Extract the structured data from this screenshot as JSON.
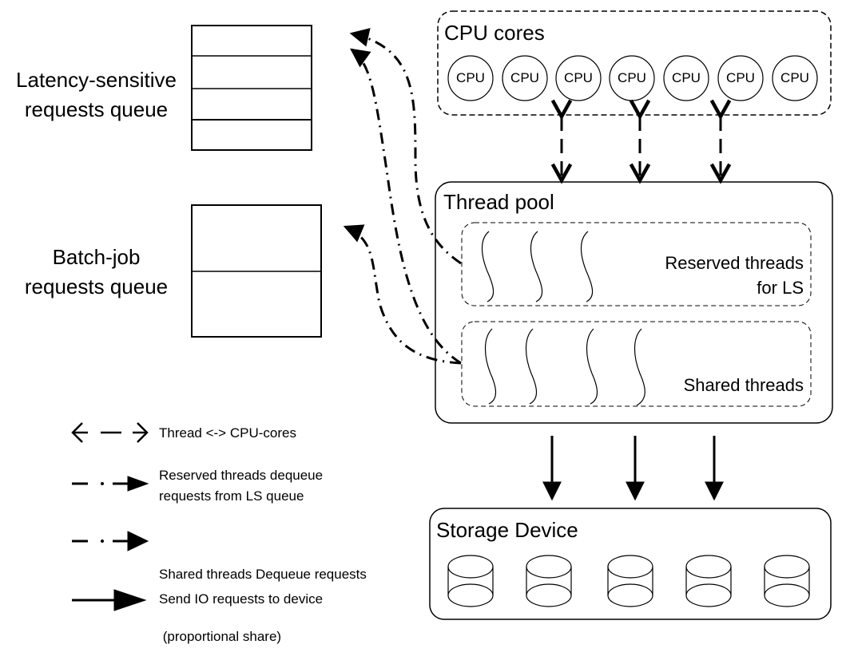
{
  "queues": {
    "ls": {
      "label_line1": "Latency-sensitive",
      "label_line2": "requests queue",
      "slots": 4
    },
    "batch": {
      "label_line1": "Batch-job",
      "label_line2": "requests queue",
      "slots": 2
    }
  },
  "cpu_cores": {
    "title": "CPU cores",
    "cores": [
      "CPU",
      "CPU",
      "CPU",
      "CPU",
      "CPU",
      "CPU",
      "CPU"
    ]
  },
  "thread_pool": {
    "title": "Thread pool",
    "reserved": {
      "label_line1": "Reserved threads",
      "label_line2": "for LS",
      "threads": 3
    },
    "shared": {
      "label": "Shared threads",
      "threads": 4
    }
  },
  "storage": {
    "title": "Storage Device",
    "disks": 5
  },
  "legend": [
    {
      "icon": "double-dashed-arrow-icon",
      "text_line1": "Thread <-> CPU-cores",
      "text_line2": ""
    },
    {
      "icon": "dash-dot-arrow-icon",
      "text_line1": "Reserved threads dequeue",
      "text_line2": "requests from LS queue"
    },
    {
      "icon": "dash-dot-arrow-icon",
      "text_line1": "Shared threads Dequeue requests",
      "text_line2": " (proportional share)"
    },
    {
      "icon": "solid-arrow-icon",
      "text_line1": "Send IO requests to device",
      "text_line2": ""
    }
  ]
}
